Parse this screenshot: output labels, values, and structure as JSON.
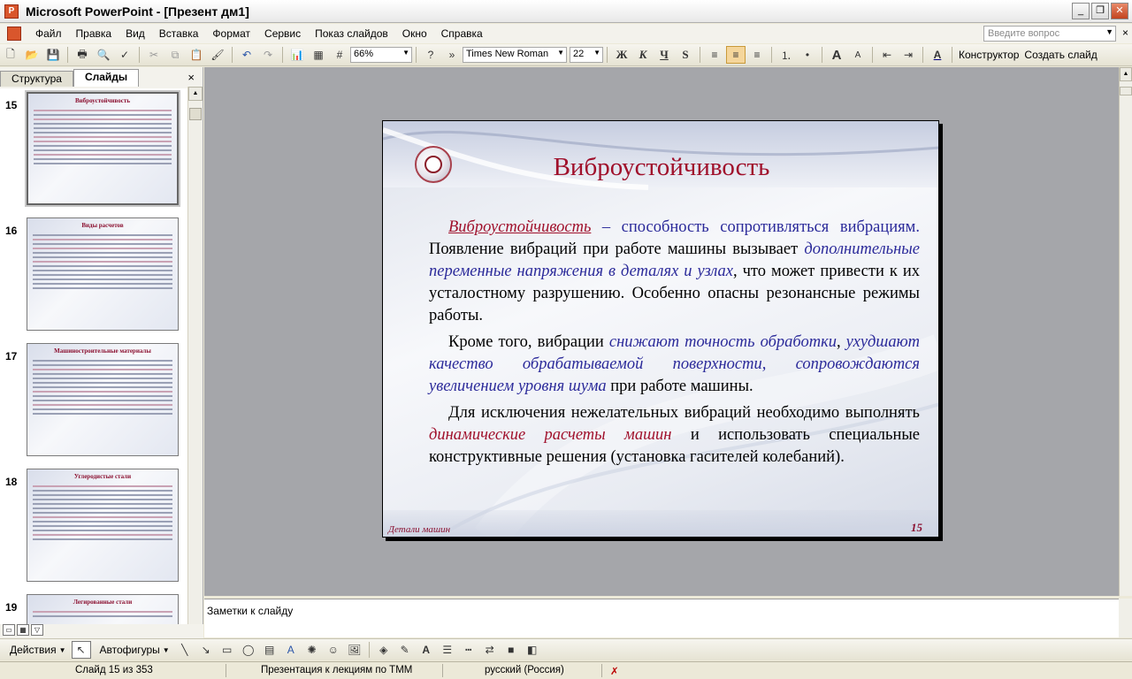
{
  "window": {
    "title": "Microsoft PowerPoint - [Презент дм1]",
    "minimize": "_",
    "restore": "❐",
    "close": "✕"
  },
  "menu": {
    "items": [
      "Файл",
      "Правка",
      "Вид",
      "Вставка",
      "Формат",
      "Сервис",
      "Показ слайдов",
      "Окно",
      "Справка"
    ],
    "help_placeholder": "Введите вопрос",
    "close": "×"
  },
  "toolbar": {
    "zoom": "66%",
    "font_name": "Times New Roman",
    "font_size": "22",
    "bold": "Ж",
    "italic": "К",
    "underline": "Ч",
    "shadow": "S",
    "designer": "Конструктор",
    "new_slide": "Создать слайд"
  },
  "left_pane": {
    "tab_outline": "Структура",
    "tab_slides": "Слайды",
    "close": "×",
    "thumbnails": [
      {
        "num": "15",
        "title": "Виброустойчивость",
        "selected": true
      },
      {
        "num": "16",
        "title": "Виды расчетов",
        "selected": false
      },
      {
        "num": "17",
        "title": "Машиностроительные материалы",
        "selected": false
      },
      {
        "num": "18",
        "title": "Углеродистые стали",
        "selected": false
      },
      {
        "num": "19",
        "title": "Легированные стали",
        "selected": false
      }
    ]
  },
  "slide": {
    "title": "Виброустойчивость",
    "p1_a": "Виброустойчивость",
    "p1_b": " – способность сопротивляться вибрациям.",
    "p1_c": " Появление вибраций при работе машины вызывает ",
    "p1_d": "дополнительные переменные напряжения в деталях и узлах",
    "p1_e": ", что может привести к их усталостному разрушению. Особенно опасны резонансные режимы работы.",
    "p2_a": "Кроме того, вибрации ",
    "p2_b": "снижают точность обработки",
    "p2_c": ", ",
    "p2_d": "ухудшают качество обрабатываемой поверхности, сопровождаются увеличением уровня шума",
    "p2_e": " при работе машины.",
    "p3_a": "Для исключения нежелательных вибраций необходимо выполнять ",
    "p3_b": "динамические расчеты машин",
    "p3_c": " и использовать специальные конструктивные решения (установка гасителей колебаний).",
    "footer": "Детали машин",
    "number": "15"
  },
  "notes": {
    "placeholder": "Заметки к слайду"
  },
  "drawbar": {
    "actions": "Действия",
    "autoshapes": "Автофигуры"
  },
  "status": {
    "slide": "Слайд 15 из 353",
    "design": "Презентация к лекциям по ТММ",
    "language": "русский (Россия)"
  },
  "colors": {
    "accent_red": "#a0102b",
    "accent_blue": "#2b2a9a"
  }
}
